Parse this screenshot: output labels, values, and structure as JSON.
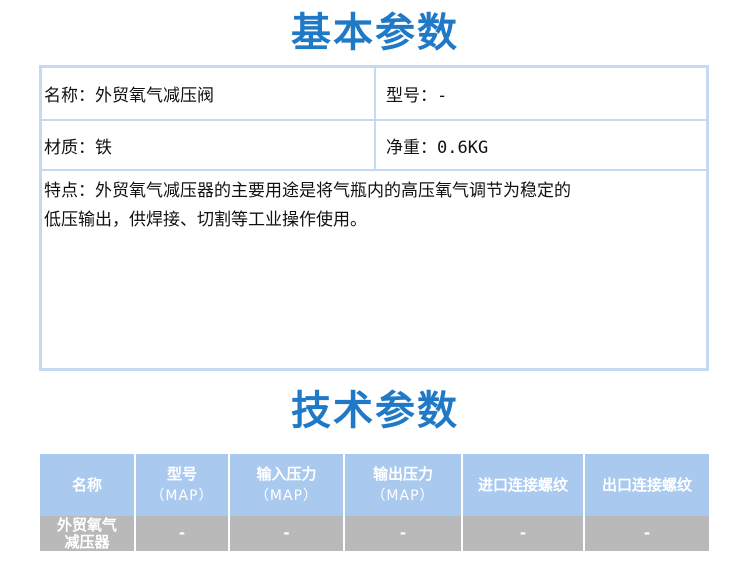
{
  "basic": {
    "title": "基本参数",
    "name": "名称：外贸氧气减压阀",
    "model": "型号：-",
    "material": "材质：铁",
    "net_weight": "净重：0.6KG",
    "features_line1": "特点：外贸氧气减压器的主要用途是将气瓶内的高压氧气调节为稳定的",
    "features_line2": "低压输出，供焊接、切割等工业操作使用。"
  },
  "tech": {
    "title": "技术参数",
    "headers": [
      {
        "label": "名称",
        "sub": ""
      },
      {
        "label": "型号",
        "sub": "（MAP）"
      },
      {
        "label": "输入压力",
        "sub": "（MAP）"
      },
      {
        "label": "输出压力",
        "sub": "（MAP）"
      },
      {
        "label": "进口连接螺纹",
        "sub": ""
      },
      {
        "label": "出口连接螺纹",
        "sub": ""
      }
    ],
    "row": {
      "name_line1": "外贸氧气",
      "name_line2": "减压器",
      "model": "-",
      "input_pressure": "-",
      "output_pressure": "-",
      "inlet_thread": "-",
      "outlet_thread": "-"
    }
  },
  "colors": {
    "title": "#1f79c7",
    "border": "#c5d9f3",
    "header_bg": "#a9c9ee",
    "row_bg": "#b9b9b9"
  }
}
